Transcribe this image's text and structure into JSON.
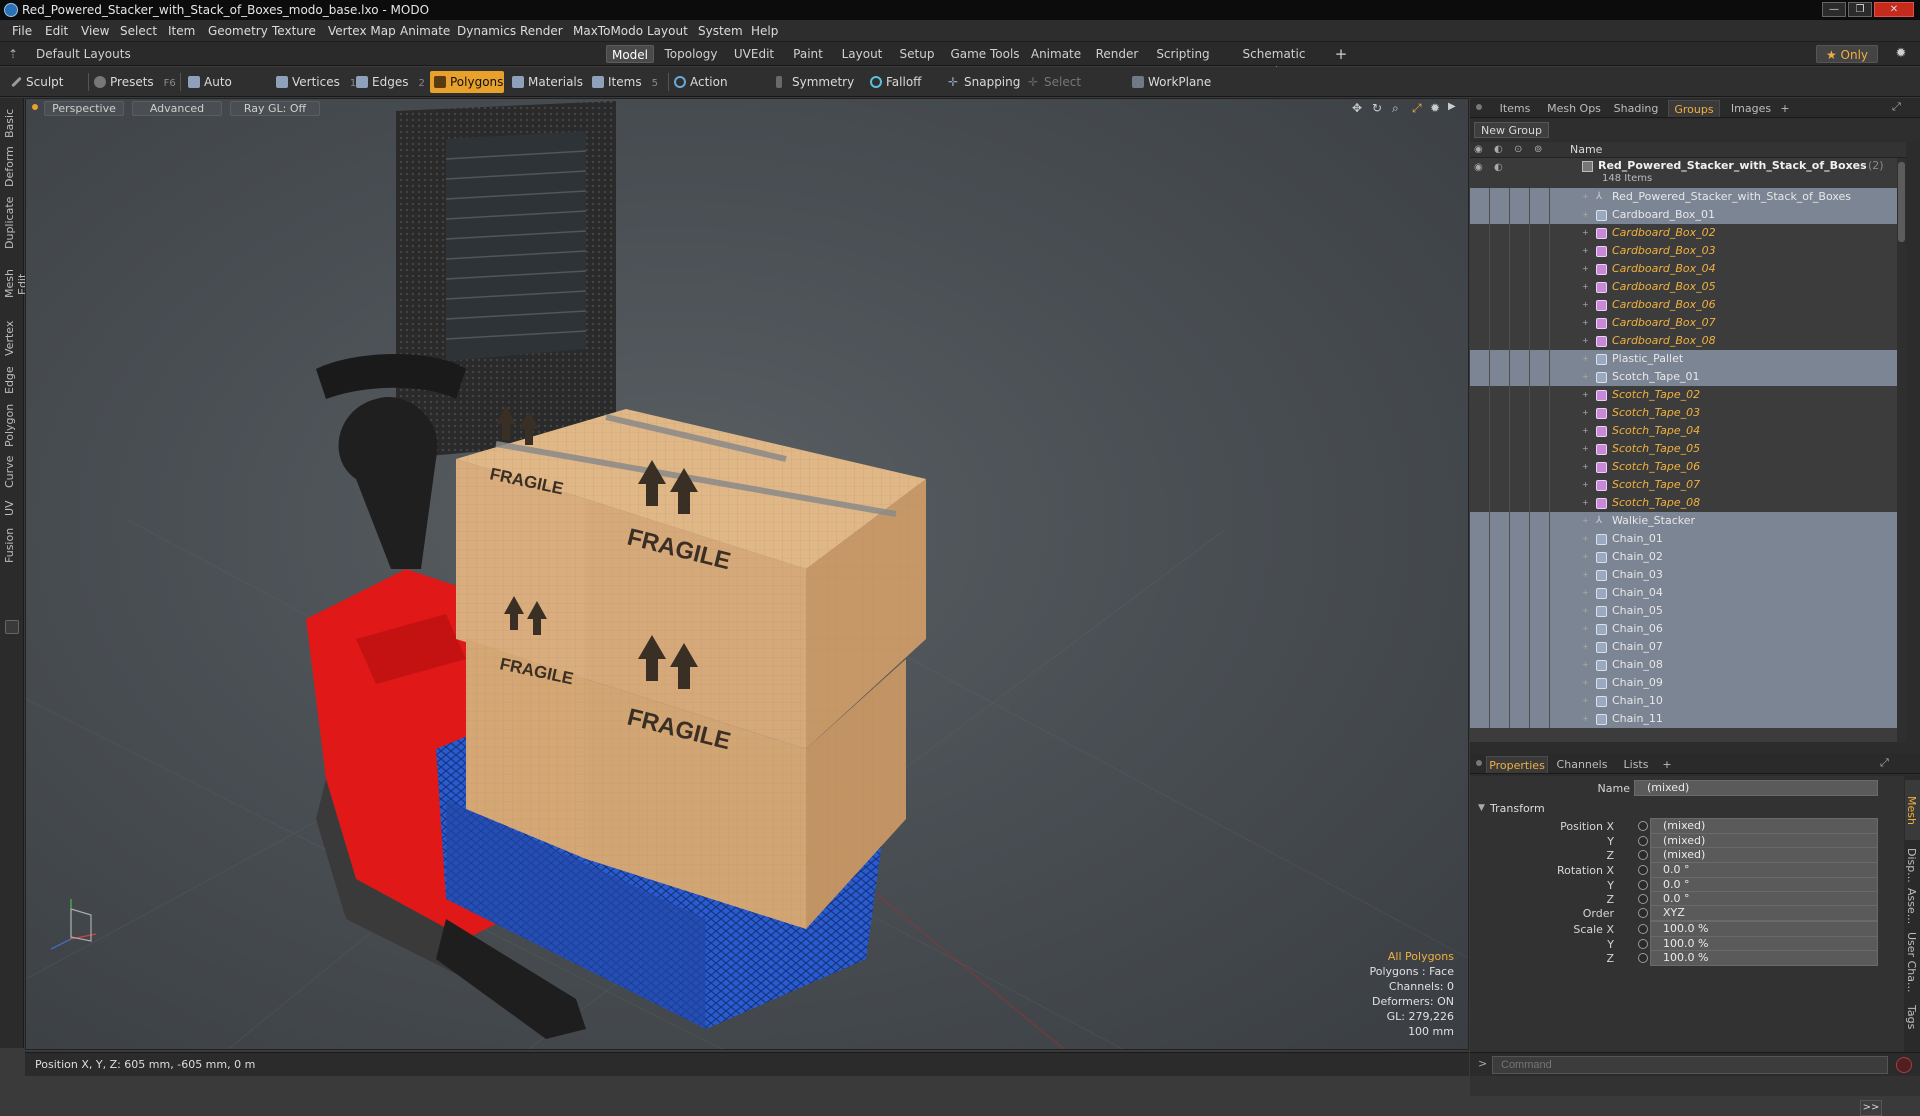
{
  "window": {
    "title": "Red_Powered_Stacker_with_Stack_of_Boxes_modo_base.lxo - MODO",
    "controls": [
      "—",
      "❐",
      "✕"
    ]
  },
  "menu": [
    "File",
    "Edit",
    "View",
    "Select",
    "Item",
    "Geometry",
    "Texture",
    "Vertex Map",
    "Animate",
    "Dynamics",
    "Render",
    "MaxToModo",
    "Layout",
    "System",
    "Help"
  ],
  "layout_bar": {
    "layout_selector": "Default Layouts ▾",
    "tabs": [
      "Model",
      "Topology",
      "UVEdit",
      "Paint",
      "Layout",
      "Setup",
      "Game Tools",
      "Animate",
      "Render",
      "Scripting",
      "Schematic Fusion"
    ],
    "active_tab": "Model",
    "add": "+",
    "only_label": "★ Only",
    "gear": "✹"
  },
  "toolbar": {
    "sculpt": "Sculpt",
    "presets": "Presets",
    "presets_key": "F6",
    "auto_select": "Auto Select",
    "vertices": "Vertices",
    "vertices_key": "1",
    "edges": "Edges",
    "edges_key": "2",
    "polygons": "Polygons",
    "materials": "Materials",
    "items": "Items",
    "items_key": "5",
    "action_center": "Action Center",
    "symmetry": "Symmetry",
    "falloff": "Falloff",
    "snapping": "Snapping",
    "select_through": "Select Through",
    "workplane": "WorkPlane"
  },
  "left_tabs": [
    "Basic",
    "Deform",
    "Duplicate",
    "Mesh Edit",
    "Vertex",
    "Edge",
    "Polygon",
    "Curve",
    "UV",
    "Fusion"
  ],
  "viewport": {
    "view_mode": "Perspective",
    "shading": "Advanced",
    "raygl": "Ray GL: Off",
    "box_label": "FRAGILE",
    "info": {
      "selection": "All Polygons",
      "polygons": "Polygons : Face",
      "channels": "Channels: 0",
      "deformers": "Deformers: ON",
      "gl": "GL: 279,226",
      "scale": "100 mm"
    }
  },
  "status": {
    "position": "Position X, Y, Z:  605 mm, -605 mm, 0 m"
  },
  "groups_panel": {
    "tabs": [
      "Items",
      "Mesh Ops",
      "Shading",
      "Groups",
      "Images",
      "+"
    ],
    "active_tab": "Groups",
    "new_group": "New Group",
    "column_name": "Name",
    "root": "Red_Powered_Stacker_with_Stack_of_Boxes",
    "root_count": "(2)",
    "root_sub": "148 Items",
    "rows": [
      {
        "name": "Red_Powered_Stacker_with_Stack_of_Boxes",
        "kind": "locator",
        "ref": false,
        "sel": true
      },
      {
        "name": "Cardboard_Box_01",
        "kind": "mesh",
        "ref": false,
        "sel": true
      },
      {
        "name": "Cardboard_Box_02",
        "kind": "pink",
        "ref": true,
        "sel": false
      },
      {
        "name": "Cardboard_Box_03",
        "kind": "pink",
        "ref": true,
        "sel": false
      },
      {
        "name": "Cardboard_Box_04",
        "kind": "pink",
        "ref": true,
        "sel": false
      },
      {
        "name": "Cardboard_Box_05",
        "kind": "pink",
        "ref": true,
        "sel": false
      },
      {
        "name": "Cardboard_Box_06",
        "kind": "pink",
        "ref": true,
        "sel": false
      },
      {
        "name": "Cardboard_Box_07",
        "kind": "pink",
        "ref": true,
        "sel": false
      },
      {
        "name": "Cardboard_Box_08",
        "kind": "pink",
        "ref": true,
        "sel": false
      },
      {
        "name": "Plastic_Pallet",
        "kind": "mesh",
        "ref": false,
        "sel": true
      },
      {
        "name": "Scotch_Tape_01",
        "kind": "mesh",
        "ref": false,
        "sel": true
      },
      {
        "name": "Scotch_Tape_02",
        "kind": "pink",
        "ref": true,
        "sel": false
      },
      {
        "name": "Scotch_Tape_03",
        "kind": "pink",
        "ref": true,
        "sel": false
      },
      {
        "name": "Scotch_Tape_04",
        "kind": "pink",
        "ref": true,
        "sel": false
      },
      {
        "name": "Scotch_Tape_05",
        "kind": "pink",
        "ref": true,
        "sel": false
      },
      {
        "name": "Scotch_Tape_06",
        "kind": "pink",
        "ref": true,
        "sel": false
      },
      {
        "name": "Scotch_Tape_07",
        "kind": "pink",
        "ref": true,
        "sel": false
      },
      {
        "name": "Scotch_Tape_08",
        "kind": "pink",
        "ref": true,
        "sel": false
      },
      {
        "name": "Walkie_Stacker",
        "kind": "locator",
        "ref": false,
        "sel": true
      },
      {
        "name": "Chain_01",
        "kind": "mesh",
        "ref": false,
        "sel": true
      },
      {
        "name": "Chain_02",
        "kind": "mesh",
        "ref": false,
        "sel": true
      },
      {
        "name": "Chain_03",
        "kind": "mesh",
        "ref": false,
        "sel": true
      },
      {
        "name": "Chain_04",
        "kind": "mesh",
        "ref": false,
        "sel": true
      },
      {
        "name": "Chain_05",
        "kind": "mesh",
        "ref": false,
        "sel": true
      },
      {
        "name": "Chain_06",
        "kind": "mesh",
        "ref": false,
        "sel": true
      },
      {
        "name": "Chain_07",
        "kind": "mesh",
        "ref": false,
        "sel": true
      },
      {
        "name": "Chain_08",
        "kind": "mesh",
        "ref": false,
        "sel": true
      },
      {
        "name": "Chain_09",
        "kind": "mesh",
        "ref": false,
        "sel": true
      },
      {
        "name": "Chain_10",
        "kind": "mesh",
        "ref": false,
        "sel": true
      },
      {
        "name": "Chain_11",
        "kind": "mesh",
        "ref": false,
        "sel": true
      }
    ]
  },
  "properties_panel": {
    "tabs": [
      "Properties",
      "Channels",
      "Lists",
      "+"
    ],
    "active_tab": "Properties",
    "name_label": "Name",
    "name_value": "(mixed)",
    "section": "Transform",
    "rows": [
      {
        "label": "Position X",
        "value": "(mixed)"
      },
      {
        "label": "Y",
        "value": "(mixed)"
      },
      {
        "label": "Z",
        "value": "(mixed)"
      },
      {
        "label": "Rotation X",
        "value": "0.0 °"
      },
      {
        "label": "Y",
        "value": "0.0 °"
      },
      {
        "label": "Z",
        "value": "0.0 °"
      },
      {
        "label": "Order",
        "value": "XYZ"
      },
      {
        "label": "Scale X",
        "value": "100.0 %"
      },
      {
        "label": "Y",
        "value": "100.0 %"
      },
      {
        "label": "Z",
        "value": "100.0 %"
      }
    ],
    "expand": ">>",
    "side_tabs": [
      "Mesh Inst...",
      "Disp...",
      "Asse...",
      "User Cha...",
      "Tags"
    ]
  },
  "command": {
    "prompt": ">",
    "placeholder": "Command"
  },
  "colors": {
    "accent": "#e8a12a",
    "reference_item": "#f0b040",
    "stacker_red": "#e01818",
    "pallet_blue": "#2a5bd0",
    "cardboard": "#d6a97a"
  }
}
